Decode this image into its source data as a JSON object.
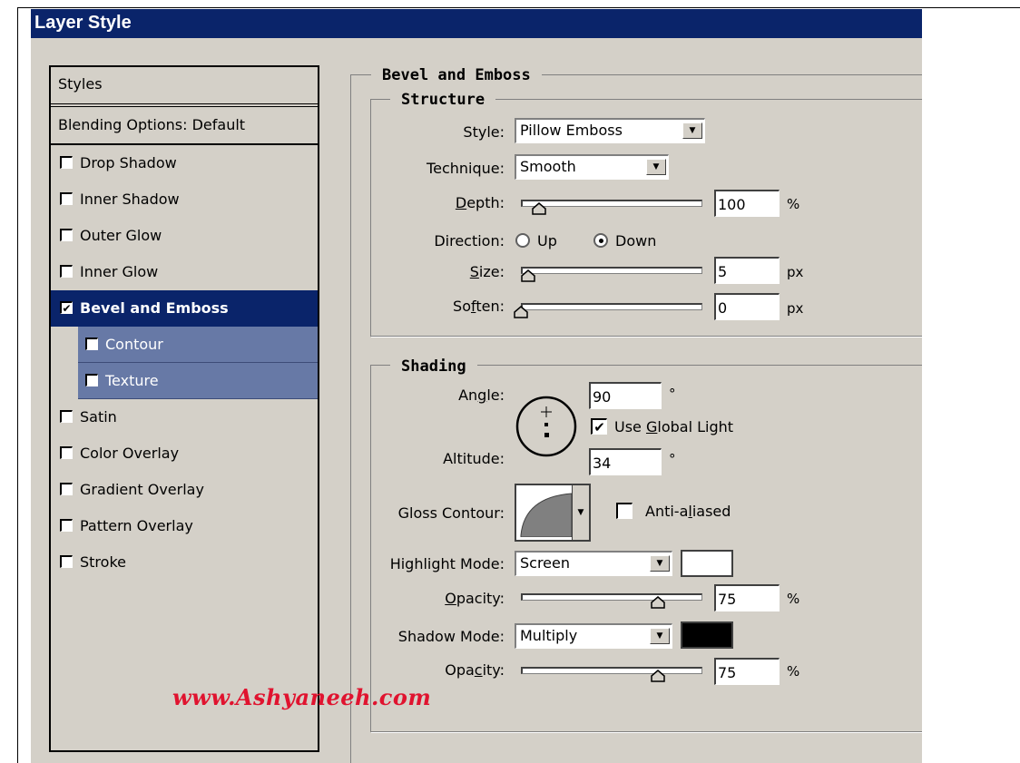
{
  "window": {
    "title": "Layer Style"
  },
  "styles_list": {
    "header": "Styles",
    "blending": "Blending Options: Default",
    "items": [
      {
        "label": "Drop Shadow",
        "checked": false
      },
      {
        "label": "Inner Shadow",
        "checked": false
      },
      {
        "label": "Outer Glow",
        "checked": false
      },
      {
        "label": "Inner Glow",
        "checked": false
      },
      {
        "label": "Bevel and Emboss",
        "checked": true,
        "selected": true
      },
      {
        "label": "Contour",
        "checked": false,
        "sub": true
      },
      {
        "label": "Texture",
        "checked": false,
        "sub": true
      },
      {
        "label": "Satin",
        "checked": false
      },
      {
        "label": "Color Overlay",
        "checked": false
      },
      {
        "label": "Gradient Overlay",
        "checked": false
      },
      {
        "label": "Pattern Overlay",
        "checked": false
      },
      {
        "label": "Stroke",
        "checked": false
      }
    ]
  },
  "bevel": {
    "title": "Bevel and Emboss",
    "structure": {
      "title": "Structure",
      "style_label": "Style:",
      "style_value": "Pillow Emboss",
      "technique_label": "Technique:",
      "technique_value": "Smooth",
      "depth_label": "Depth:",
      "depth_value": "100",
      "depth_unit": "%",
      "depth_level": 0.1,
      "direction_label": "Direction:",
      "direction_up": "Up",
      "direction_down": "Down",
      "direction_selected": "Down",
      "size_label": "Size:",
      "size_value": "5",
      "size_unit": "px",
      "size_level": 0.03,
      "soften_label": "Soften:",
      "soften_value": "0",
      "soften_unit": "px",
      "soften_level": 0.0
    },
    "shading": {
      "title": "Shading",
      "angle_label": "Angle:",
      "angle_value": "90",
      "angle_unit": "°",
      "use_global_light": "Use Global Light",
      "use_global_light_checked": true,
      "altitude_label": "Altitude:",
      "altitude_value": "34",
      "altitude_unit": "°",
      "gloss_label": "Gloss Contour:",
      "anti_aliased": "Anti-aliased",
      "anti_aliased_checked": false,
      "highlight_label": "Highlight Mode:",
      "highlight_value": "Screen",
      "highlight_color": "#ffffff",
      "highlight_opacity_label": "Opacity:",
      "highlight_opacity_value": "75",
      "highlight_opacity_unit": "%",
      "highlight_opacity_level": 0.75,
      "shadow_label": "Shadow Mode:",
      "shadow_value": "Multiply",
      "shadow_color": "#000000",
      "shadow_opacity_label": "Opacity:",
      "shadow_opacity_value": "75",
      "shadow_opacity_unit": "%",
      "shadow_opacity_level": 0.75
    }
  },
  "watermark": "www.Ashyaneeh.com",
  "colors": {
    "titlebar": "#0a246a",
    "dialog_bg": "#d4d0c8",
    "selected_row": "#0a246a",
    "sub_row": "#6779a6",
    "watermark": "#e0132f"
  }
}
